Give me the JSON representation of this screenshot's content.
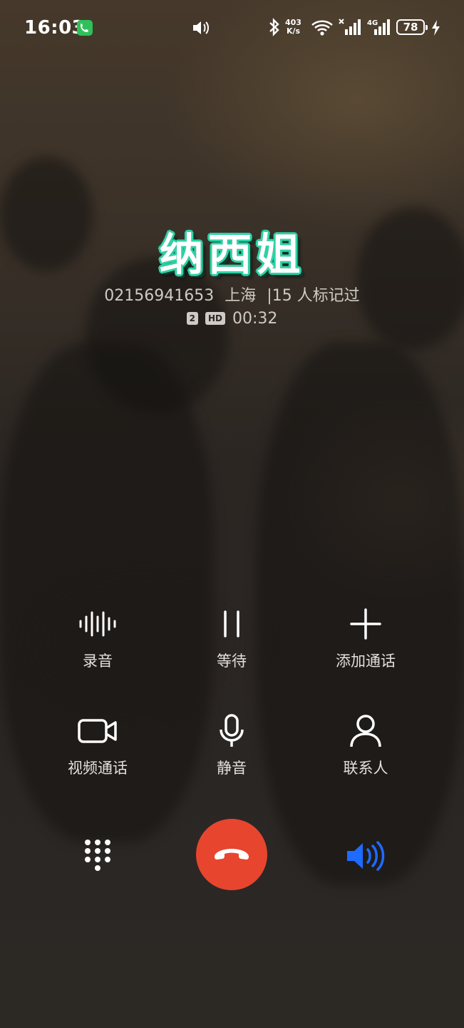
{
  "status_bar": {
    "time": "16:03",
    "net_speed_value": "403",
    "net_speed_unit": "K/s",
    "network_type": "4G",
    "battery": "78",
    "call_indicator_color": "#2fc05a"
  },
  "caller": {
    "name": "纳西姐",
    "number": "02156941653",
    "location": "上海",
    "tag": "|15 人标记过",
    "sim_slot": "2",
    "hd_label": "HD",
    "duration": "00:32"
  },
  "actions": {
    "record": "录音",
    "hold": "等待",
    "add_call": "添加通话",
    "video_call": "视频通话",
    "mute": "静音",
    "contacts": "联系人"
  },
  "colors": {
    "end_call": "#e8452f",
    "speaker_active": "#1f6bff",
    "name_outline": "#2bd3a5"
  }
}
